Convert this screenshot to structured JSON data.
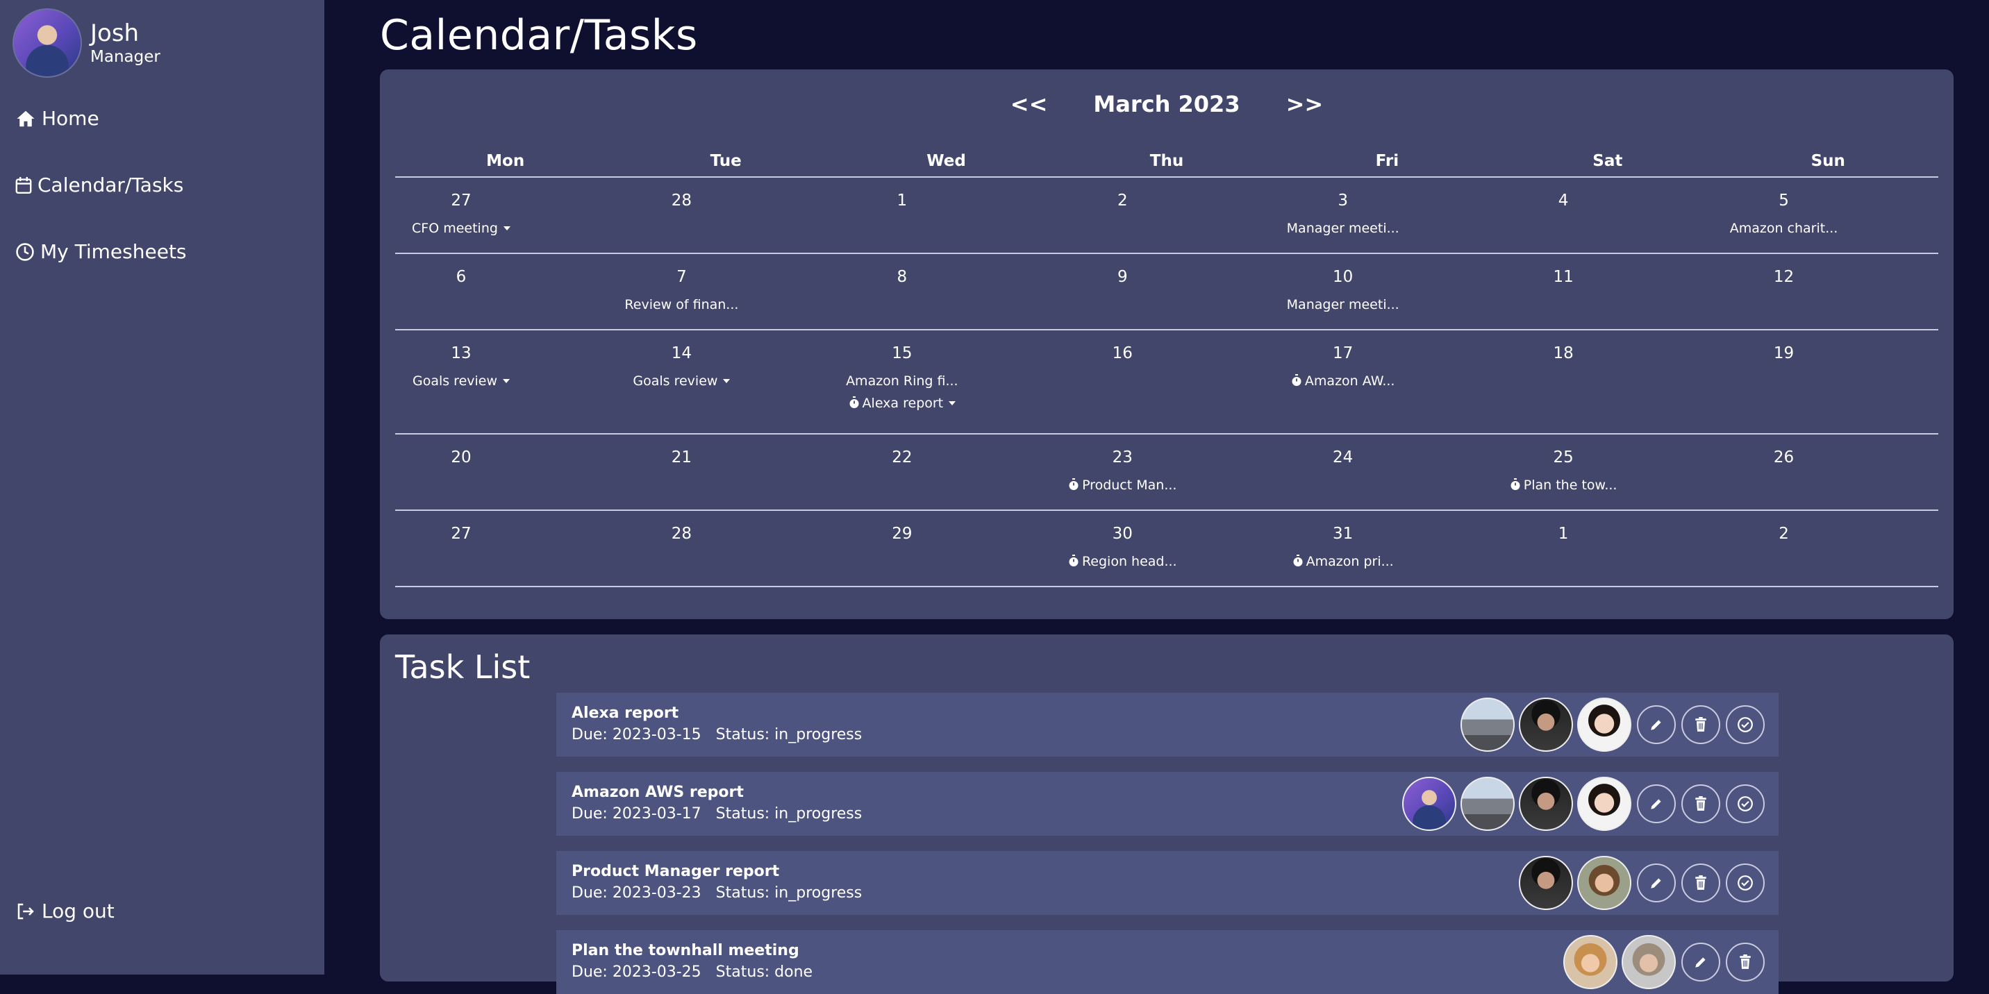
{
  "user": {
    "name": "Josh",
    "role": "Manager"
  },
  "nav": {
    "home": "Home",
    "calendar": "Calendar/Tasks",
    "timesheets": "My Timesheets",
    "logout": "Log out"
  },
  "page": {
    "title": "Calendar/Tasks"
  },
  "calendar": {
    "prev": "<<",
    "next": ">>",
    "month": "March 2023",
    "days": [
      "Mon",
      "Tue",
      "Wed",
      "Thu",
      "Fri",
      "Sat",
      "Sun"
    ],
    "weeks": [
      [
        {
          "d": "27",
          "events": [
            {
              "text": "CFO meeting",
              "caret": true
            }
          ]
        },
        {
          "d": "28",
          "events": []
        },
        {
          "d": "1",
          "events": []
        },
        {
          "d": "2",
          "events": []
        },
        {
          "d": "3",
          "events": [
            {
              "text": "Manager meeti..."
            }
          ]
        },
        {
          "d": "4",
          "events": []
        },
        {
          "d": "5",
          "events": [
            {
              "text": "Amazon charit..."
            }
          ]
        }
      ],
      [
        {
          "d": "6",
          "events": []
        },
        {
          "d": "7",
          "events": [
            {
              "text": "Review of finan..."
            }
          ]
        },
        {
          "d": "8",
          "events": []
        },
        {
          "d": "9",
          "events": []
        },
        {
          "d": "10",
          "events": [
            {
              "text": "Manager meeti..."
            }
          ]
        },
        {
          "d": "11",
          "events": []
        },
        {
          "d": "12",
          "events": []
        }
      ],
      [
        {
          "d": "13",
          "events": [
            {
              "text": "Goals review",
              "caret": true
            }
          ]
        },
        {
          "d": "14",
          "events": [
            {
              "text": "Goals review",
              "caret": true
            }
          ]
        },
        {
          "d": "15",
          "events": [
            {
              "text": "Amazon Ring fi..."
            },
            {
              "text": "Alexa report",
              "timer": true,
              "caret": true
            }
          ]
        },
        {
          "d": "16",
          "events": []
        },
        {
          "d": "17",
          "events": [
            {
              "text": "Amazon AW...",
              "timer": true
            }
          ]
        },
        {
          "d": "18",
          "events": []
        },
        {
          "d": "19",
          "events": []
        }
      ],
      [
        {
          "d": "20",
          "events": []
        },
        {
          "d": "21",
          "events": []
        },
        {
          "d": "22",
          "events": []
        },
        {
          "d": "23",
          "events": [
            {
              "text": "Product Man...",
              "timer": true
            }
          ]
        },
        {
          "d": "24",
          "events": []
        },
        {
          "d": "25",
          "events": [
            {
              "text": "Plan the tow...",
              "timer": true
            }
          ]
        },
        {
          "d": "26",
          "events": []
        }
      ],
      [
        {
          "d": "27",
          "events": []
        },
        {
          "d": "28",
          "events": []
        },
        {
          "d": "29",
          "events": []
        },
        {
          "d": "30",
          "events": [
            {
              "text": "Region head...",
              "timer": true
            }
          ]
        },
        {
          "d": "31",
          "events": [
            {
              "text": "Amazon pri...",
              "timer": true
            }
          ]
        },
        {
          "d": "1",
          "events": []
        },
        {
          "d": "2",
          "events": []
        }
      ]
    ]
  },
  "tasks": {
    "title": "Task List",
    "items": [
      {
        "name": "Alexa report",
        "due": "Due: 2023-03-15",
        "status": "Status: in_progress",
        "avatars": [
          "mountain",
          "dark",
          "woman"
        ],
        "complete": true
      },
      {
        "name": "Amazon AWS report",
        "due": "Due: 2023-03-17",
        "status": "Status: in_progress",
        "avatars": [
          "josh",
          "mountain",
          "dark",
          "woman"
        ],
        "complete": true
      },
      {
        "name": "Product Manager report",
        "due": "Due: 2023-03-23",
        "status": "Status: in_progress",
        "avatars": [
          "dark",
          "glasses"
        ],
        "complete": true
      },
      {
        "name": "Plan the townhall meeting",
        "due": "Due: 2023-03-25",
        "status": "Status: done",
        "avatars": [
          "blonde",
          "gray"
        ],
        "complete": false
      }
    ]
  }
}
